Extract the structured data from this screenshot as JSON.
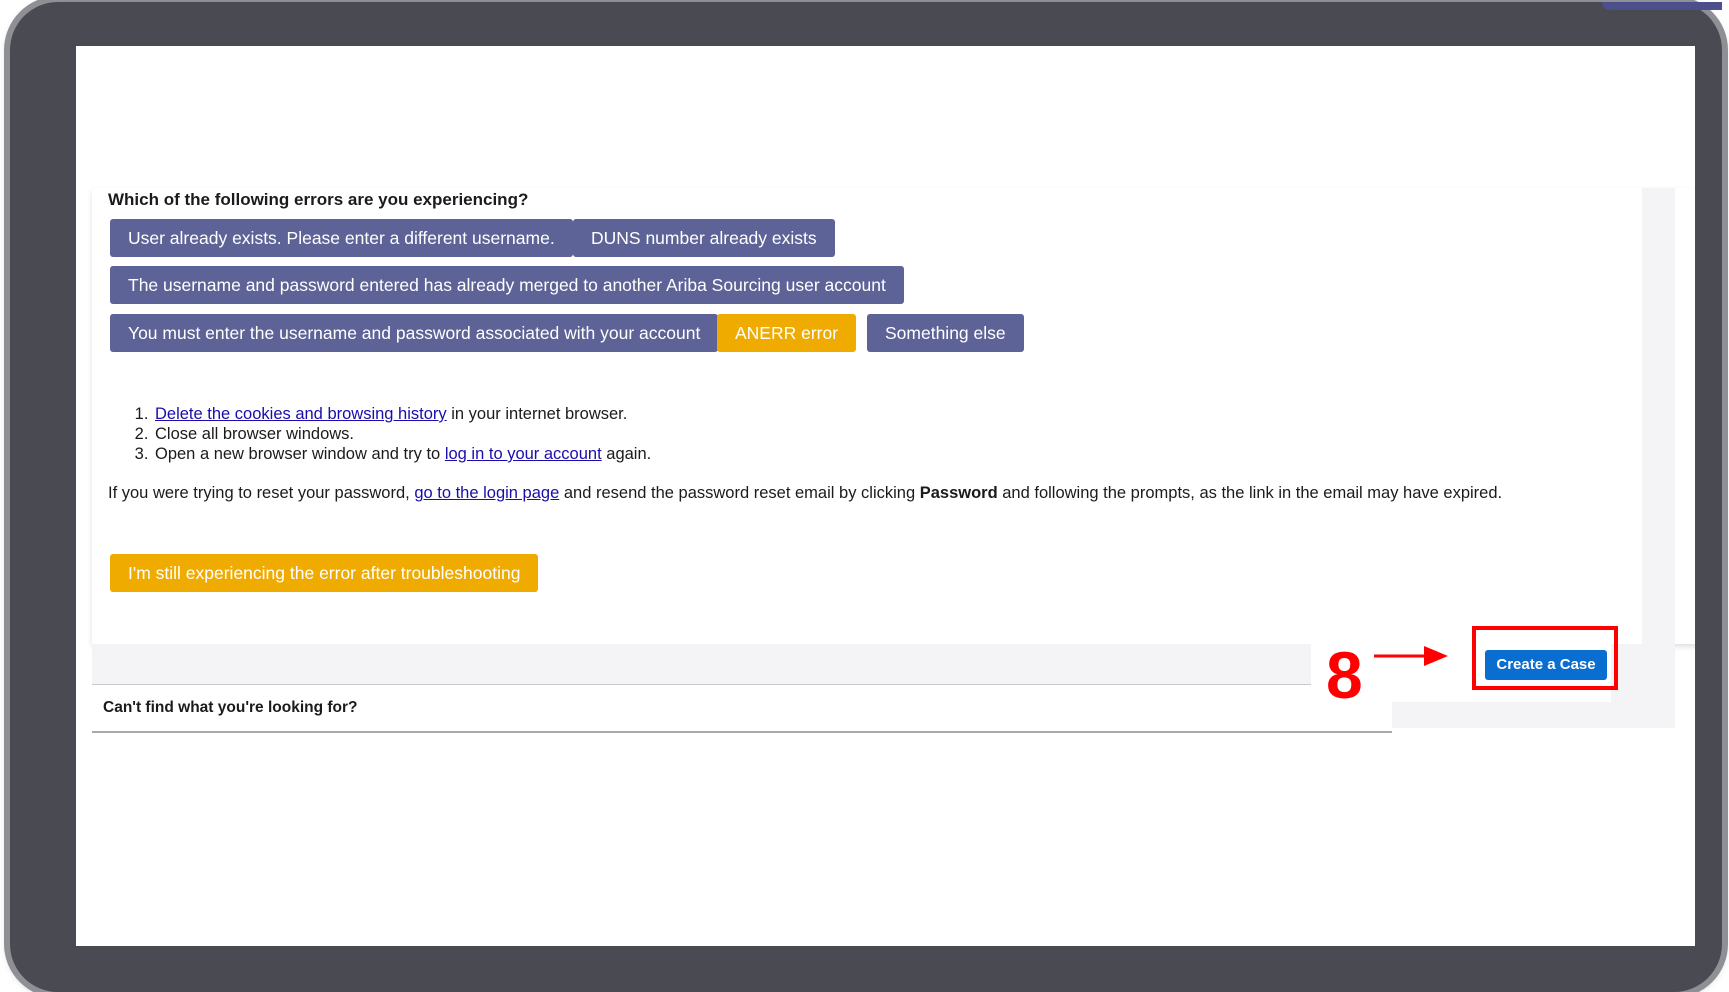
{
  "question": "Which of the following errors are you experiencing?",
  "error_options": [
    "User already exists. Please enter a different username.",
    "DUNS number already exists",
    "The username and password entered has already merged to another Ariba Sourcing user account",
    "You must enter the username and password associated with your account",
    "ANERR error",
    "Something else"
  ],
  "steps": {
    "step1": {
      "link": "Delete the cookies and browsing history",
      "text": " in your internet browser."
    },
    "step2": {
      "text": "Close all browser windows."
    },
    "step3": {
      "text_before": "Open a new browser window and try to ",
      "link": "log in to your account",
      "text_after": " again."
    }
  },
  "reset_info": {
    "text_before": "If you were trying to reset your password, ",
    "link": "go to the login page",
    "text_middle": " and resend the password reset email by clicking ",
    "bold": "Password",
    "text_after": " and following the prompts, as the link in the email may have expired."
  },
  "still_error_button": "I'm still experiencing the error after troubleshooting",
  "footer": {
    "prompt": "Can't find what you're looking for?",
    "create_case_button": "Create a Case"
  },
  "annotation": {
    "step_number": "8",
    "color": "#ff0000"
  },
  "colors": {
    "option_button": "#5e6397",
    "selected_button": "#f0ab00",
    "primary_button": "#0a6ed1",
    "frame": "#4a4b52"
  }
}
